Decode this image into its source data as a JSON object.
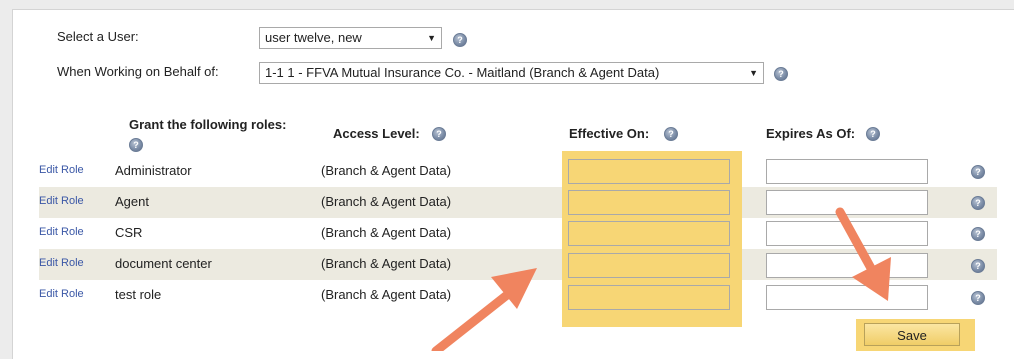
{
  "form": {
    "select_user_label": "Select a User:",
    "selected_user": "user twelve, new",
    "behalf_label": "When Working on Behalf of:",
    "selected_behalf": "1-1 1 - FFVA Mutual Insurance Co. - Maitland (Branch & Agent Data)"
  },
  "table": {
    "headers": {
      "grant": "Grant the following roles:",
      "access": "Access Level:",
      "effective": "Effective On:",
      "expires": "Expires As Of:"
    },
    "edit_label": "Edit Role",
    "rows": [
      {
        "role": "Administrator",
        "access": "(Branch & Agent Data)"
      },
      {
        "role": "Agent",
        "access": "(Branch & Agent Data)"
      },
      {
        "role": "CSR",
        "access": "(Branch & Agent Data)"
      },
      {
        "role": "document center",
        "access": "(Branch & Agent Data)"
      },
      {
        "role": "test role",
        "access": "(Branch & Agent Data)"
      }
    ]
  },
  "save_label": "Save",
  "icons": {
    "help": "help-question-icon",
    "caret": "caret-down-icon"
  },
  "colors": {
    "highlight": "#f7d675",
    "arrow": "#f0845f",
    "link": "#3a57a6",
    "row_alt": "#eceae0"
  }
}
